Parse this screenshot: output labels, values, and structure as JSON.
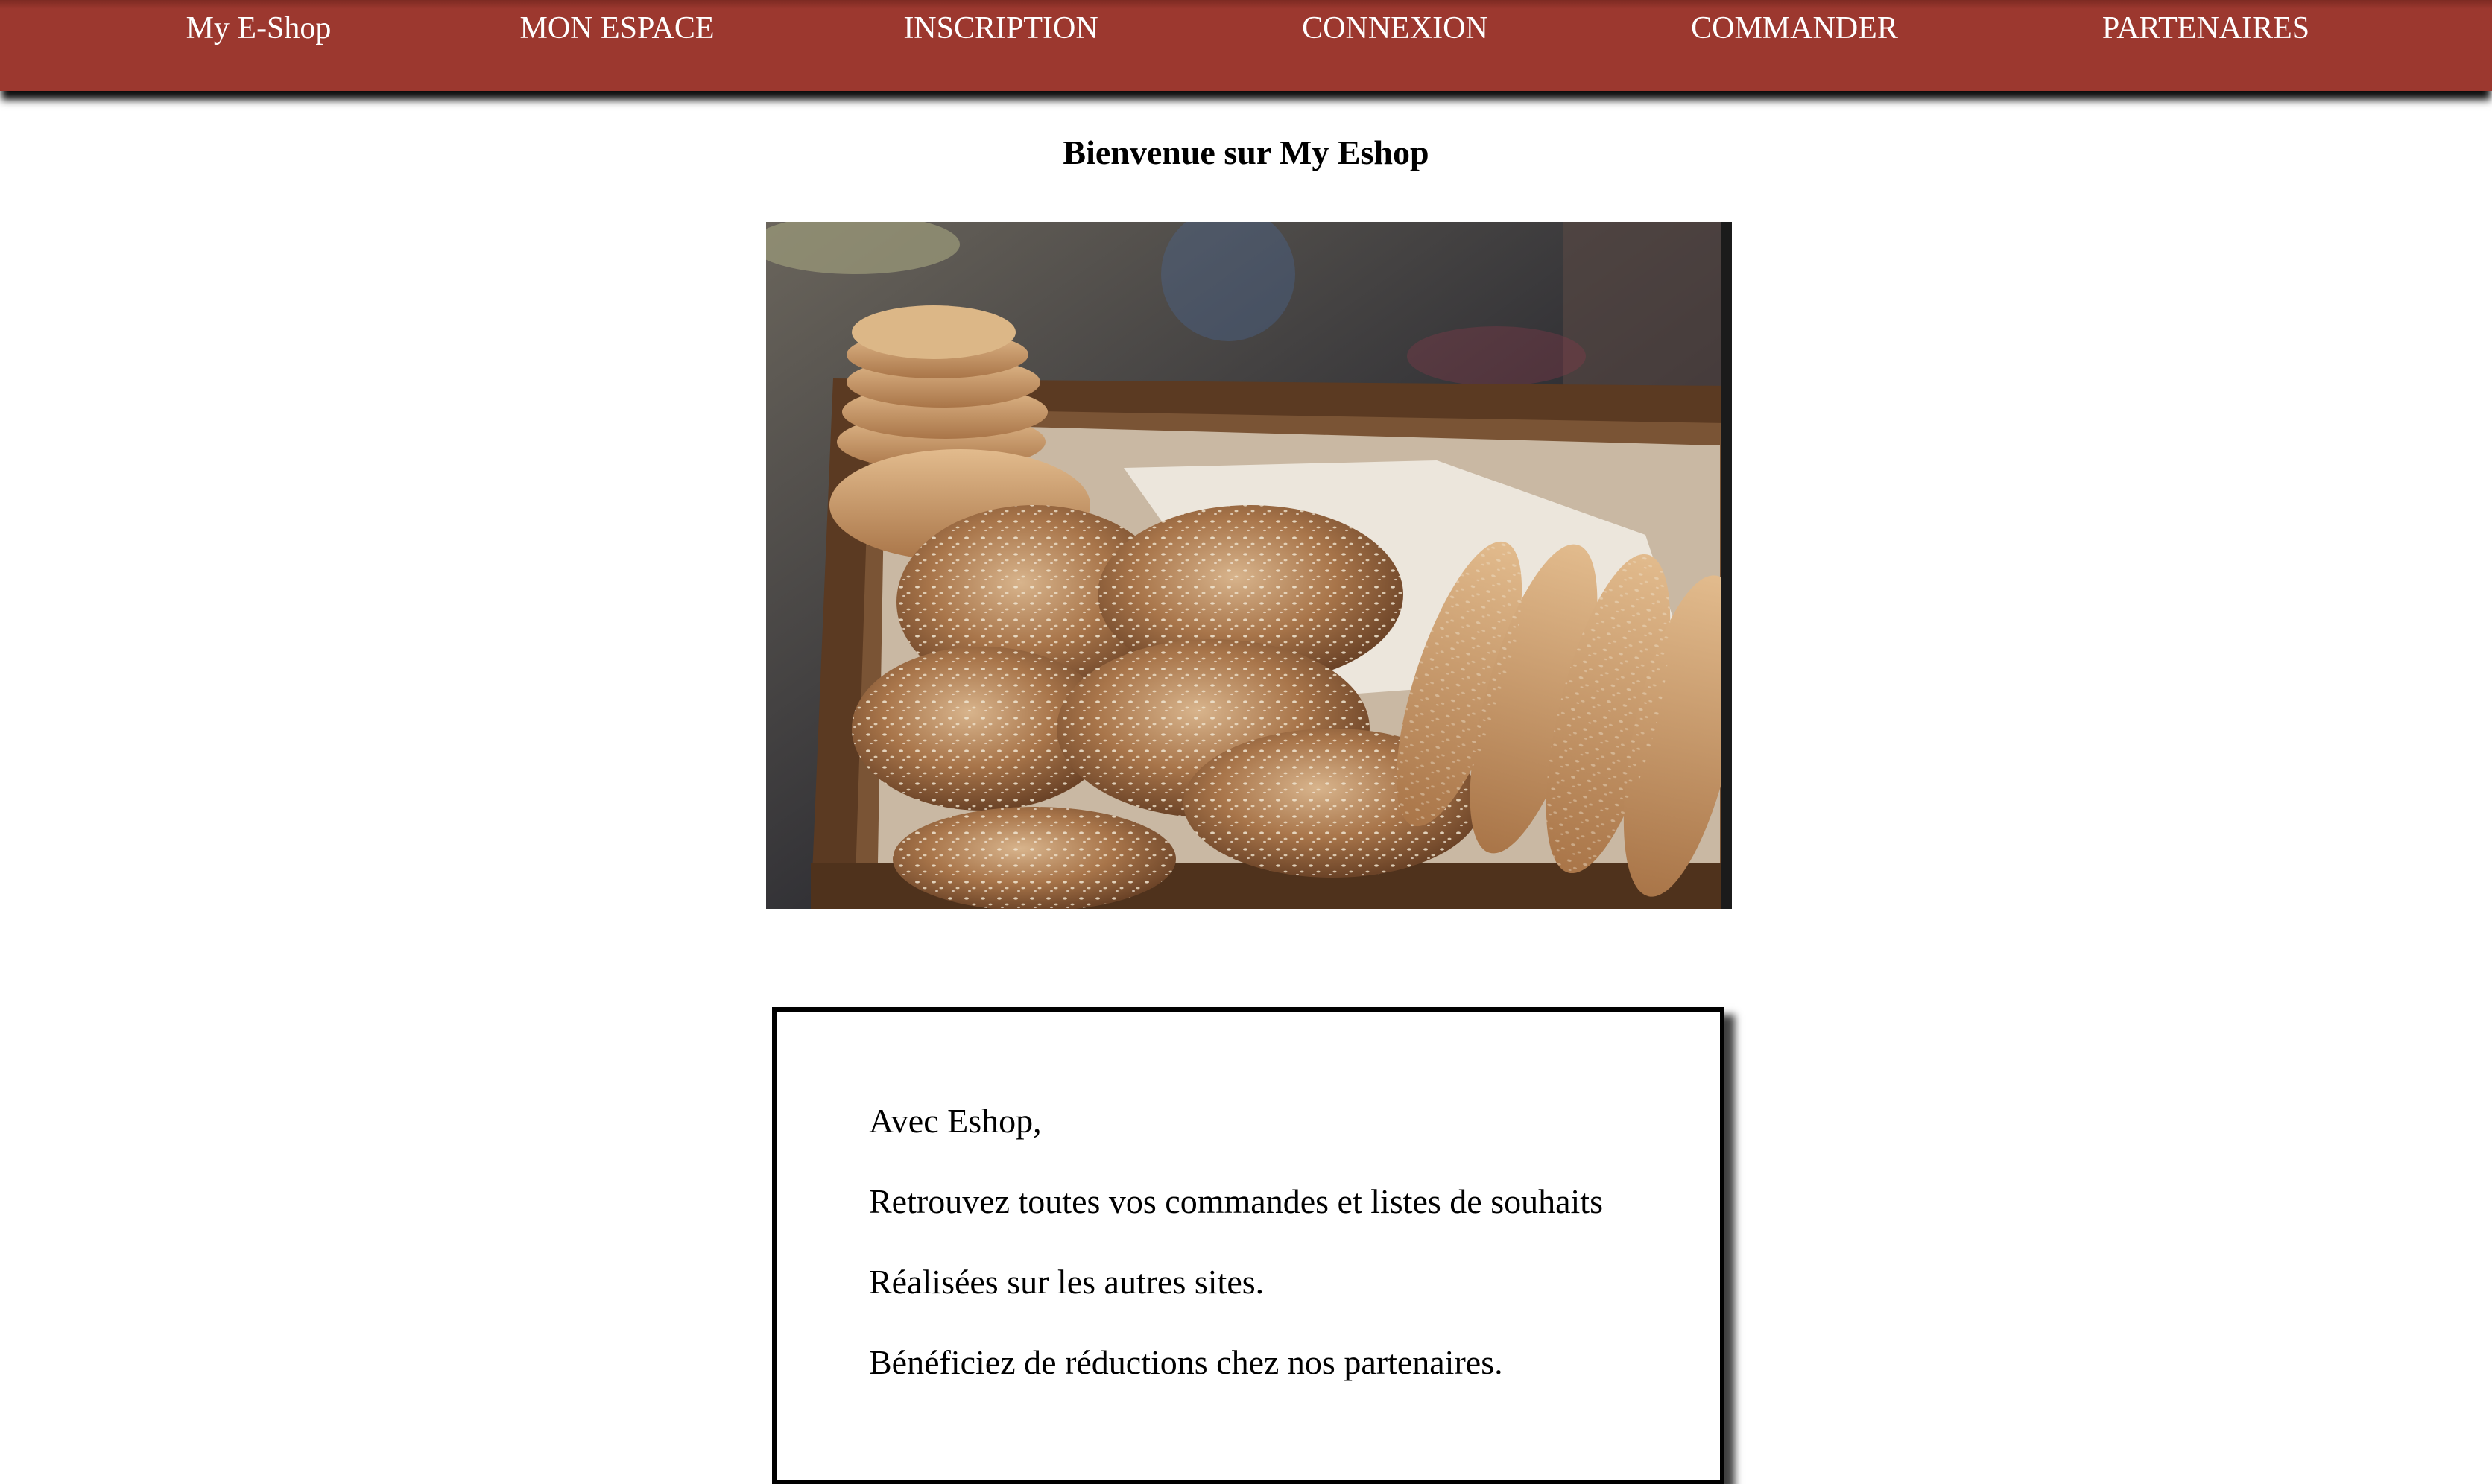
{
  "nav": {
    "brand": "My E-Shop",
    "items": [
      {
        "label": "MON ESPACE"
      },
      {
        "label": "INSCRIPTION"
      },
      {
        "label": "CONNEXION"
      },
      {
        "label": "COMMANDER"
      },
      {
        "label": "PARTENAIRES"
      }
    ]
  },
  "main": {
    "title": "Bienvenue sur My Eshop",
    "image_icon": "bread-image",
    "intro_lines": [
      "Avec Eshop,",
      "Retrouvez toutes vos commandes et listes de souhaits",
      "Réalisées sur les autres sites.",
      "Bénéficiez de réductions chez nos partenaires."
    ]
  },
  "colors": {
    "navbar": "#9c382f",
    "nav_text": "#ffffff",
    "page_background": "#ffffff",
    "text": "#000000"
  }
}
